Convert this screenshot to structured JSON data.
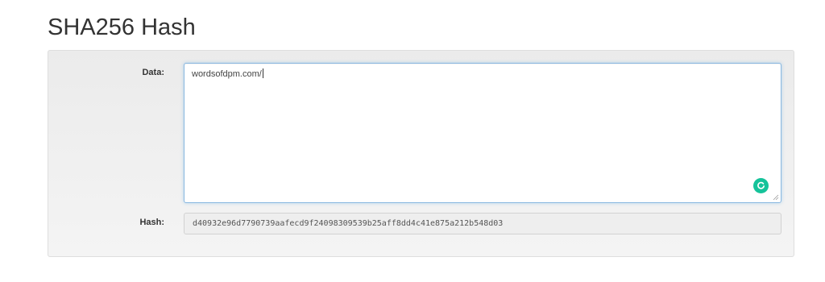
{
  "page": {
    "title": "SHA256 Hash"
  },
  "form": {
    "data_label": "Data:",
    "data_value": "wordsofdpm.com/",
    "hash_label": "Hash:",
    "hash_value": "d40932e96d7790739aafecd9f24098309539b25aff8dd4c41e875a212b548d03"
  },
  "icons": {
    "grammar_badge": "grammarly-icon",
    "resize": "resize-grip-icon"
  },
  "colors": {
    "badge": "#15c39a",
    "focus_border": "#8ab8e0"
  }
}
